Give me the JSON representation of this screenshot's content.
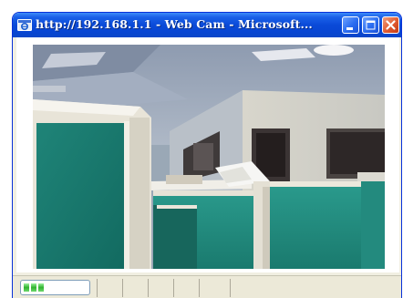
{
  "window": {
    "title": "http://192.168.1.1 - Web Cam - Microsoft...",
    "title_icon": "ie-browser-icon",
    "buttons": {
      "minimize_icon": "minimize-icon",
      "maximize_icon": "maximize-icon",
      "close_icon": "close-icon"
    }
  },
  "camera": {
    "feed_description_icon": "webcam-feed"
  },
  "statusbar": {
    "progress_blocks": 3,
    "progress_color": "#2fb32f"
  },
  "colors": {
    "titlebar": "#0a4ad8",
    "close_button": "#e05a30",
    "window_face": "#ece9d8"
  }
}
